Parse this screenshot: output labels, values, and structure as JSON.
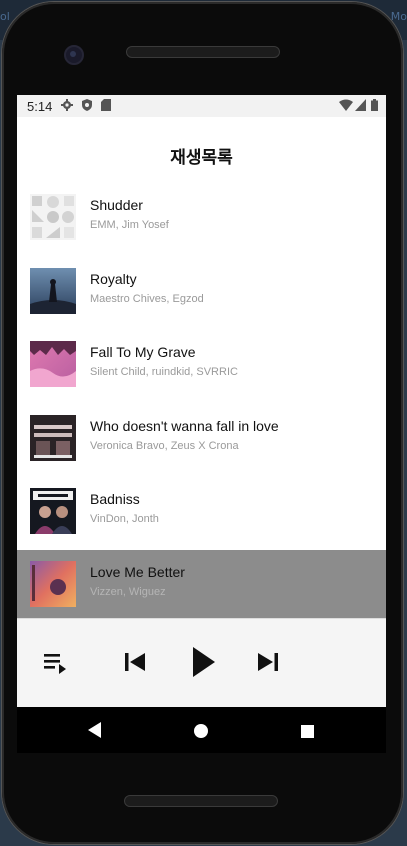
{
  "background": {
    "left_text": "ol",
    "right_text": "Mo"
  },
  "status_bar": {
    "time": "5:14"
  },
  "app": {
    "title": "재생목록"
  },
  "playlist": [
    {
      "title": "Shudder",
      "artist": "EMM, Jim Yosef",
      "art": "pattern-art"
    },
    {
      "title": "Royalty",
      "artist": "Maestro Chives, Egzod",
      "art": "sky-art"
    },
    {
      "title": "Fall To My Grave",
      "artist": "Silent Child, ruindkid, SVRRIC",
      "art": "pink-art"
    },
    {
      "title": "Who doesn't wanna fall in love",
      "artist": "Veronica Bravo, Zeus X Crona",
      "art": "fall-in-love-art"
    },
    {
      "title": "Badniss",
      "artist": "VinDon, Jonth",
      "art": "badniss-art"
    },
    {
      "title": "Love Me Better",
      "artist": "Vizzen, Wiguez",
      "art": "sunset-art"
    }
  ],
  "player": {
    "active_index": 5
  },
  "colors": {
    "active_row": "#8c8c8c",
    "artist_text": "#9a9a9a"
  }
}
